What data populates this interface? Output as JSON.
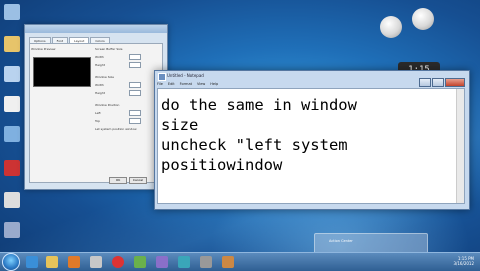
{
  "desktop": {
    "icons": [
      {
        "name": "recycle-bin-icon",
        "color": "#9bbfe4"
      },
      {
        "name": "folder-icon",
        "color": "#e7c46a"
      },
      {
        "name": "computer-icon",
        "color": "#b9d3ef"
      },
      {
        "name": "document-icon",
        "color": "#f0f0f0"
      },
      {
        "name": "network-icon",
        "color": "#7fb0e0"
      },
      {
        "name": "app-icon",
        "color": "#c33"
      },
      {
        "name": "disc-icon",
        "color": "#ddd"
      },
      {
        "name": "shortcut-icon",
        "color": "#9ac"
      },
      {
        "name": "control-icon",
        "color": "#bbb"
      }
    ]
  },
  "gadgets": {
    "clock_text": "1:15"
  },
  "back_window": {
    "tabs": [
      "Options",
      "Font",
      "Layout",
      "Colors"
    ],
    "active_tab": "Layout",
    "preview_label": "Window Preview",
    "group_buffer": "Screen Buffer Size",
    "width_label": "Width",
    "height_label": "Height",
    "group_size": "Window Size",
    "group_position": "Window Position",
    "left_label": "Left",
    "top_label": "Top",
    "let_system_label": "Let system position window",
    "ok_label": "OK",
    "cancel_label": "Cancel"
  },
  "notepad": {
    "title": "Untitled - Notepad",
    "menu": [
      "File",
      "Edit",
      "Format",
      "View",
      "Help"
    ],
    "content": "do the same in window\nsize\nuncheck \"left system\npositiowindow"
  },
  "notification": {
    "text": "Action Center"
  },
  "taskbar": {
    "icons": [
      {
        "name": "ie-icon",
        "color": "#3a8fd8"
      },
      {
        "name": "explorer-icon",
        "color": "#e6c35a"
      },
      {
        "name": "media-icon",
        "color": "#e07a2a"
      },
      {
        "name": "app1-icon",
        "color": "#c8c8c8"
      },
      {
        "name": "app2-icon",
        "color": "#d33"
      },
      {
        "name": "app3-icon",
        "color": "#6ab04c"
      },
      {
        "name": "app4-icon",
        "color": "#8a6fc9"
      },
      {
        "name": "app5-icon",
        "color": "#3aa6b9"
      },
      {
        "name": "app6-icon",
        "color": "#999"
      },
      {
        "name": "app7-icon",
        "color": "#cc8844"
      }
    ],
    "time": "1:15 PM",
    "date": "3/16/2012"
  }
}
